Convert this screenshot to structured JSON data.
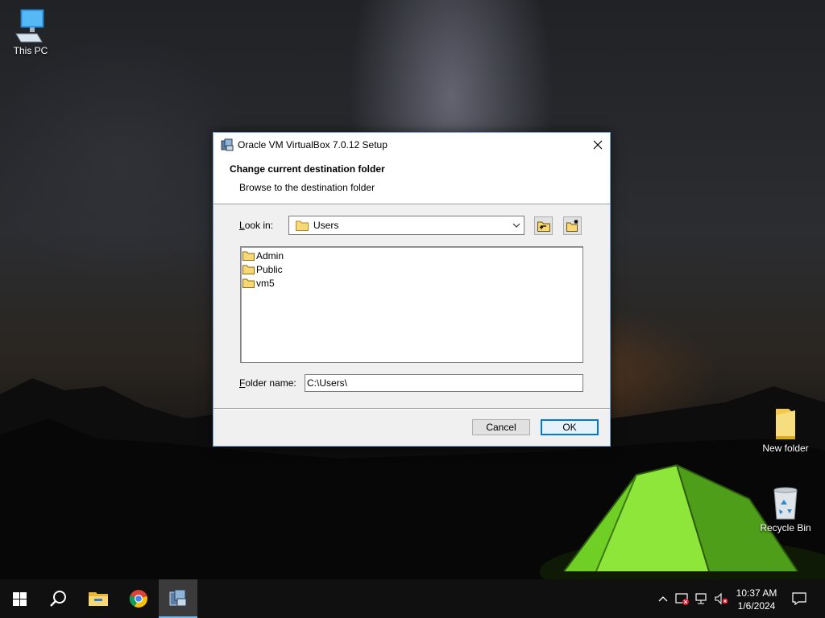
{
  "desktop": {
    "icons": [
      {
        "label": "This PC"
      },
      {
        "label": "New folder"
      },
      {
        "label": "Recycle Bin"
      }
    ]
  },
  "dialog": {
    "title": "Oracle VM VirtualBox 7.0.12 Setup",
    "header_title": "Change current destination folder",
    "header_subtitle": "Browse to the destination folder",
    "look_in_label_prefix": "L",
    "look_in_label_rest": "ook in:",
    "look_in_value": "Users",
    "folders": [
      "Admin",
      "Public",
      "vm5"
    ],
    "folder_name_label_prefix": "F",
    "folder_name_label_rest": "older name:",
    "folder_name_value": "C:\\Users\\",
    "cancel_label": "Cancel",
    "ok_label": "OK"
  },
  "taskbar": {
    "time": "10:37 AM",
    "date": "1/6/2024"
  },
  "colors": {
    "accent": "#0078d7",
    "taskbar": "#101010",
    "folder_yellow": "#f8d775"
  }
}
